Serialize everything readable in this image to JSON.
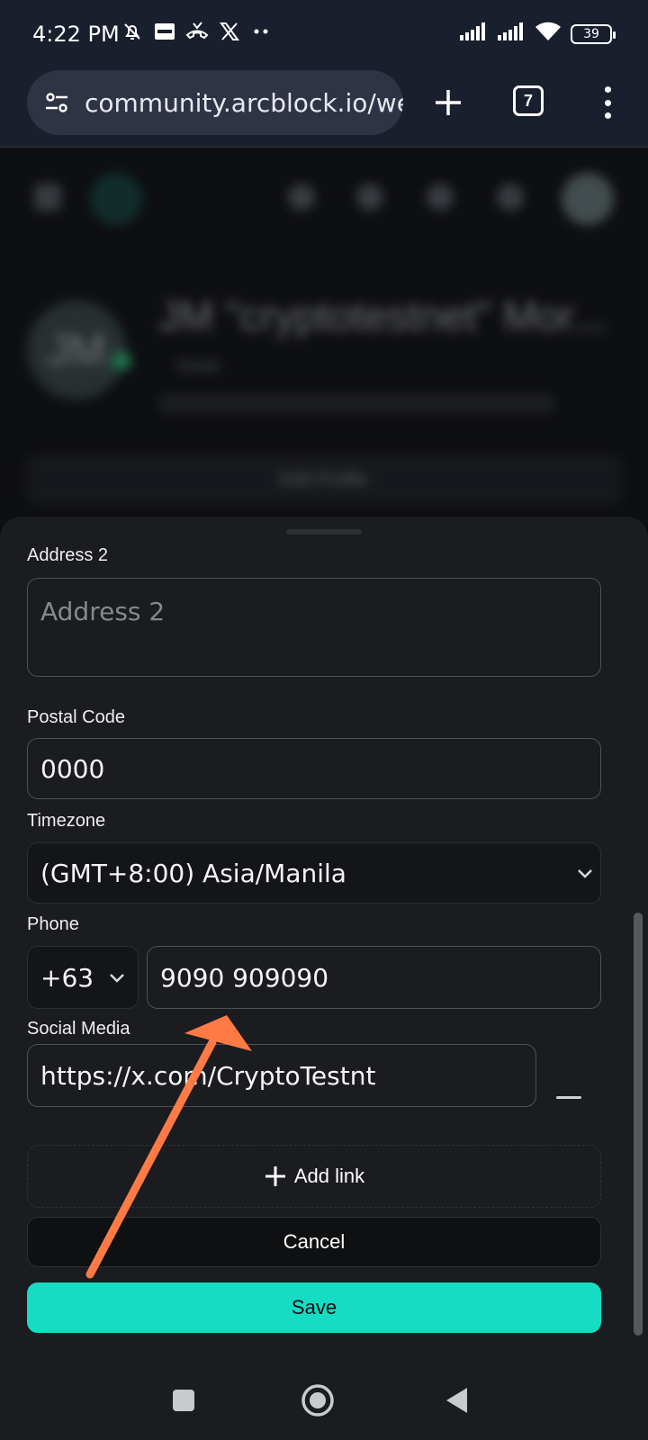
{
  "status_bar": {
    "time": "4:22 PM",
    "battery": "39",
    "left_icons": [
      "mute-bell-icon",
      "bybit-icon",
      "missed-call-icon",
      "x-logo-icon",
      "more-dots-icon"
    ],
    "right_icons": [
      "signal-icon",
      "signal-icon",
      "wifi-icon",
      "battery-icon"
    ]
  },
  "browser": {
    "url": "community.arcblock.io/web",
    "tab_count": "7"
  },
  "background_page": {
    "profile_name": "JM \"cryptotestnet\" Mor...",
    "avatar_initials": "JM",
    "subtitle": "Guest",
    "edit_profile": "Edit Profile"
  },
  "form": {
    "address2": {
      "label": "Address 2",
      "placeholder": "Address 2"
    },
    "postal_code": {
      "label": "Postal Code",
      "value": "0000"
    },
    "timezone": {
      "label": "Timezone",
      "value": "(GMT+8:00) Asia/Manila"
    },
    "phone": {
      "label": "Phone",
      "country_code": "+63",
      "number": "9090 909090"
    },
    "social_media": {
      "label": "Social Media",
      "value": "https://x.com/CryptoTestnt"
    },
    "add_link": "Add link",
    "cancel": "Cancel",
    "save": "Save"
  },
  "colors": {
    "accent": "#16dcc4",
    "annotation_arrow": "#ff7a45",
    "sheet_bg": "#1b1c20",
    "browser_bg": "#1a1f2e"
  }
}
